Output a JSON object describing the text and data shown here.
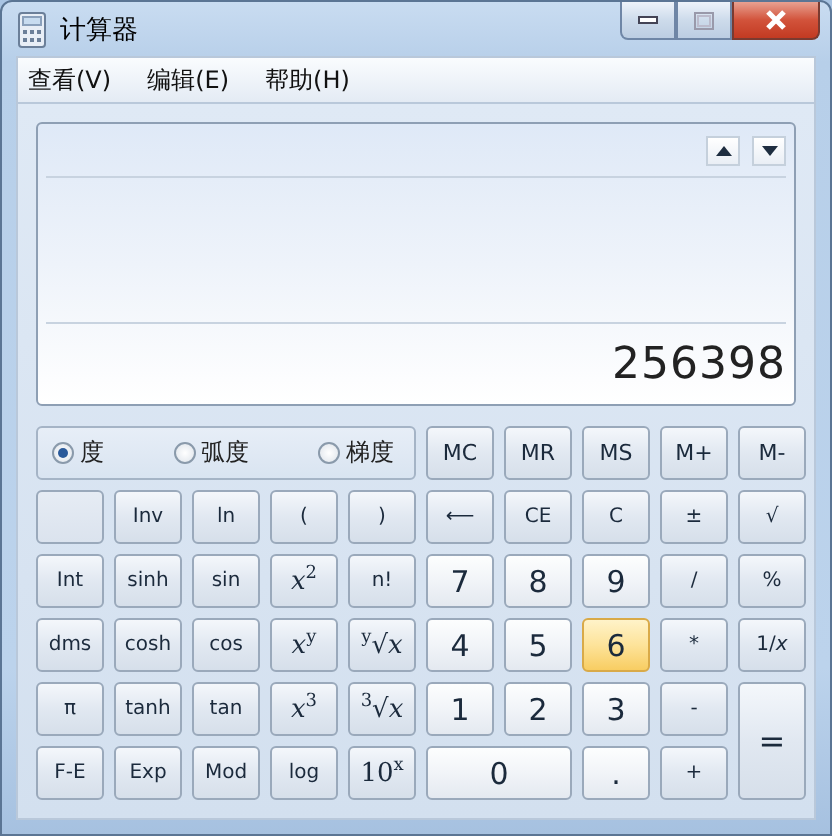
{
  "window": {
    "title": "计算器"
  },
  "menu": [
    {
      "label": "查看(V)"
    },
    {
      "label": "编辑(E)"
    },
    {
      "label": "帮助(H)"
    }
  ],
  "display": {
    "value": "256398"
  },
  "angle_units": [
    {
      "label": "度",
      "selected": true
    },
    {
      "label": "弧度",
      "selected": false
    },
    {
      "label": "梯度",
      "selected": false
    }
  ],
  "memory_buttons": [
    "MC",
    "MR",
    "MS",
    "M+",
    "M-"
  ],
  "keys": [
    {
      "kind": "blank",
      "highlighted": false
    },
    {
      "label": "Inv",
      "kind": "function",
      "highlighted": false
    },
    {
      "label": "ln",
      "kind": "function",
      "highlighted": false
    },
    {
      "label": "(",
      "kind": "function",
      "highlighted": false
    },
    {
      "label": ")",
      "kind": "function",
      "highlighted": false
    },
    {
      "label": "⟵",
      "kind": "function",
      "highlighted": false
    },
    {
      "label": "CE",
      "kind": "function",
      "highlighted": false
    },
    {
      "label": "C",
      "kind": "function",
      "highlighted": false
    },
    {
      "label": "±",
      "kind": "function",
      "highlighted": false
    },
    {
      "label": "√",
      "kind": "function",
      "highlighted": false
    },
    {
      "label": "Int",
      "kind": "function",
      "highlighted": false
    },
    {
      "label": "sinh",
      "kind": "function",
      "highlighted": false
    },
    {
      "label": "sin",
      "kind": "function",
      "highlighted": false
    },
    {
      "label": "*x*$^{2}$",
      "kind": "math",
      "highlighted": false
    },
    {
      "label": "n!",
      "kind": "function",
      "highlighted": false
    },
    {
      "label": "7",
      "kind": "digit",
      "highlighted": false
    },
    {
      "label": "8",
      "kind": "digit",
      "highlighted": false
    },
    {
      "label": "9",
      "kind": "digit",
      "highlighted": false
    },
    {
      "label": "/",
      "kind": "function",
      "highlighted": false
    },
    {
      "label": "%",
      "kind": "function",
      "highlighted": false
    },
    {
      "label": "dms",
      "kind": "function",
      "highlighted": false
    },
    {
      "label": "cosh",
      "kind": "function",
      "highlighted": false
    },
    {
      "label": "cos",
      "kind": "function",
      "highlighted": false
    },
    {
      "label": "*x*$^{y}$",
      "kind": "math",
      "highlighted": false
    },
    {
      "label": "$^{y}$√*x*",
      "kind": "math",
      "highlighted": false
    },
    {
      "label": "4",
      "kind": "digit",
      "highlighted": false
    },
    {
      "label": "5",
      "kind": "digit",
      "highlighted": false
    },
    {
      "label": "6",
      "kind": "digit",
      "highlighted": true
    },
    {
      "label": "*",
      "kind": "function",
      "highlighted": false
    },
    {
      "label": "1/*x*",
      "kind": "function",
      "highlighted": false
    },
    {
      "label": "π",
      "kind": "function",
      "highlighted": false
    },
    {
      "label": "tanh",
      "kind": "function",
      "highlighted": false
    },
    {
      "label": "tan",
      "kind": "function",
      "highlighted": false
    },
    {
      "label": "*x*$^{3}$",
      "kind": "math",
      "highlighted": false
    },
    {
      "label": "$^{3}$√*x*",
      "kind": "math",
      "highlighted": false
    },
    {
      "label": "1",
      "kind": "digit",
      "highlighted": false
    },
    {
      "label": "2",
      "kind": "digit",
      "highlighted": false
    },
    {
      "label": "3",
      "kind": "digit",
      "highlighted": false
    },
    {
      "label": "-",
      "kind": "function",
      "highlighted": false
    },
    {
      "label": "=",
      "kind": "equals",
      "highlighted": false
    },
    {
      "label": "F-E",
      "kind": "function",
      "highlighted": false
    },
    {
      "label": "Exp",
      "kind": "function",
      "highlighted": false
    },
    {
      "label": "Mod",
      "kind": "function",
      "highlighted": false
    },
    {
      "label": "log",
      "kind": "function",
      "highlighted": false
    },
    {
      "label": "10$^{x}$",
      "kind": "math",
      "highlighted": false
    },
    {
      "label": "0",
      "kind": "zero",
      "highlighted": false
    },
    {
      "label": ".",
      "kind": "digit",
      "highlighted": false
    },
    {
      "label": "+",
      "kind": "function",
      "highlighted": false
    }
  ]
}
